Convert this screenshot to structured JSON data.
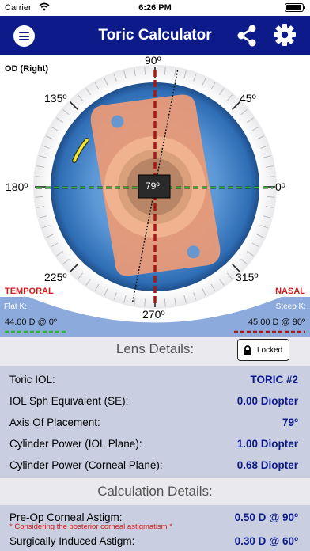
{
  "status_bar": {
    "carrier": "Carrier",
    "time": "6:26 PM"
  },
  "nav": {
    "title": "Toric Calculator",
    "menu_icon": "hamburger-menu-icon",
    "share_icon": "share-icon",
    "settings_icon": "gear-icon"
  },
  "eye": {
    "eye_label": "OD (Right)",
    "temporal": "TEMPORAL",
    "nasal": "NASAL",
    "axis_labels": {
      "a0": "0º",
      "a45": "45º",
      "a90": "90º",
      "a135": "135º",
      "a180": "180º",
      "a225": "225º",
      "a270": "270º",
      "a315": "315º"
    },
    "center_value": "79º",
    "flat_k_label": "Flat K:",
    "flat_k_value": "44.00 D  @  0º",
    "steep_k_label": "Steep K:",
    "steep_k_value": "45.00 D  @  90º",
    "iris_color": "#3b7ec4",
    "lens_color": "#e99a78",
    "flat_axis_color": "#1e8f1e",
    "steep_axis_color": "#a11a1a",
    "iol_axis_deg": 79,
    "flat_axis_deg": 0,
    "steep_axis_deg": 90
  },
  "lens_details": {
    "header": "Lens Details:",
    "locked_label": "Locked",
    "rows": [
      {
        "label": "Toric IOL:",
        "value": "TORIC #2"
      },
      {
        "label": "IOL Sph Equivalent (SE):",
        "value": "0.00 Diopter"
      },
      {
        "label": "Axis Of Placement:",
        "value": "79º"
      },
      {
        "label": "Cylinder Power (IOL Plane):",
        "value": "1.00 Diopter"
      },
      {
        "label": "Cylinder Power (Corneal Plane):",
        "value": "0.68 Diopter"
      }
    ]
  },
  "calculation_details": {
    "header": "Calculation Details:",
    "rows": [
      {
        "label": "Pre-Op Corneal Astigm:",
        "value": "0.50 D @ 90º",
        "note": "* Considering the posterior corneal astigmatism *"
      },
      {
        "label": "Surgically Induced Astigm:",
        "value": "0.30 D @ 60º"
      }
    ]
  },
  "colors": {
    "nav_bg": "#0d1a8a",
    "value_text": "#0d1a8a",
    "accent_red": "#d21c1c",
    "row_bg": "#c9cfe1"
  }
}
